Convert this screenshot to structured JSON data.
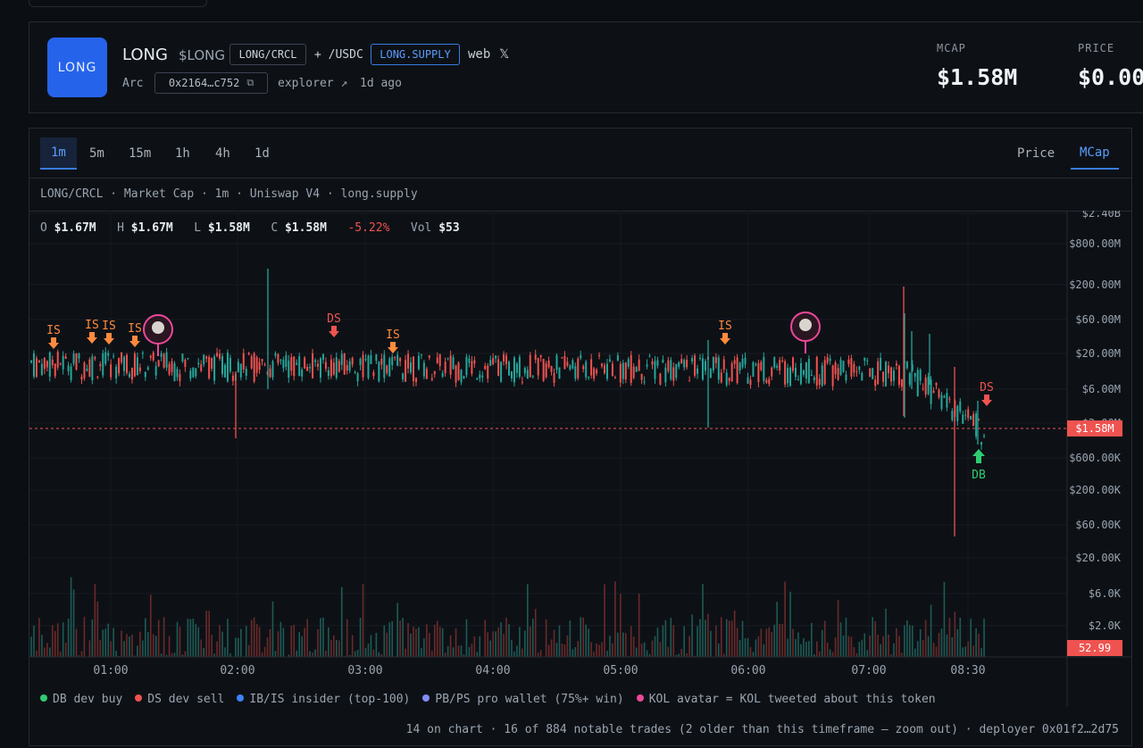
{
  "header": {
    "logo_text": "LONG",
    "name": "LONG",
    "symbol": "$LONG",
    "pair_pill": "LONG/CRCL",
    "quote": "+ /USDC",
    "site_pill": "LONG.SUPPLY",
    "web_label": "web",
    "x_label": "𝕏",
    "chain": "Arc",
    "address": "0x2164…c752",
    "copy_glyph": "⧉",
    "explorer": "explorer ↗",
    "age": "1d ago",
    "mcap_label": "MCAP",
    "mcap_value": "$1.58M",
    "price_label": "PRICE",
    "price_value": "$0.00"
  },
  "timeframes": [
    "1m",
    "5m",
    "15m",
    "1h",
    "4h",
    "1d"
  ],
  "active_timeframe": "1m",
  "modes": [
    "Price",
    "MCap"
  ],
  "active_mode": "MCap",
  "info_line": "LONG/CRCL · Market Cap · 1m · Uniswap V4 · long.supply",
  "ohlc": {
    "o_label": "O",
    "o": "$1.67M",
    "h_label": "H",
    "h": "$1.67M",
    "l_label": "L",
    "l": "$1.58M",
    "c_label": "C",
    "c": "$1.58M",
    "change": "-5.22%",
    "vol_label": "Vol",
    "vol": "$53"
  },
  "chart_data": {
    "type": "candlestick",
    "y_scale": "log",
    "y_ticks": [
      "$2.40B",
      "$800.00M",
      "$200.00M",
      "$60.00M",
      "$20.00M",
      "$6.00M",
      "$2.00M",
      "$600.00K",
      "$200.00K",
      "$60.00K",
      "$20.00K",
      "$6.0K",
      "$2.0K"
    ],
    "x_ticks": [
      "01:00",
      "02:00",
      "03:00",
      "04:00",
      "05:00",
      "06:00",
      "07:00",
      "08:30"
    ],
    "current_value_label": "$1.58M",
    "volume_label": "52.99",
    "approx_level_millions": {
      "start": 15,
      "mid": 13,
      "late": 12,
      "end": 1.58
    },
    "markers": [
      {
        "label": "IS",
        "time": "00:30",
        "dir": "down"
      },
      {
        "label": "IS",
        "time": "00:40",
        "dir": "down"
      },
      {
        "label": "IS",
        "time": "00:48",
        "dir": "down"
      },
      {
        "label": "IS",
        "time": "00:58",
        "dir": "down"
      },
      {
        "label": "DS",
        "time": "02:45",
        "dir": "down"
      },
      {
        "label": "IS",
        "time": "03:12",
        "dir": "down"
      },
      {
        "label": "IS",
        "time": "06:00",
        "dir": "down"
      },
      {
        "label": "DS",
        "time": "08:38",
        "dir": "down"
      },
      {
        "label": "DB",
        "time": "08:35",
        "dir": "up"
      }
    ],
    "colors": {
      "up": "#26a69a",
      "down": "#ef5350",
      "is": "#ff8a3d",
      "ds": "#ef5350",
      "db": "#2ecc71"
    }
  },
  "legend": [
    {
      "color": "#2ecc71",
      "text": "DB dev buy"
    },
    {
      "color": "#ef5350",
      "text": "DS dev sell"
    },
    {
      "color": "#3b82f6",
      "text": "IB/IS insider (top-100)"
    },
    {
      "color": "#818cf8",
      "text": "PB/PS pro wallet (75%+ win)"
    },
    {
      "color": "#ec4899",
      "text": "KOL avatar = KOL tweeted about this token"
    }
  ],
  "footer": "14 on chart · 16 of 884 notable trades (2 older than this timeframe — zoom out) · deployer 0x01f2…2d75"
}
